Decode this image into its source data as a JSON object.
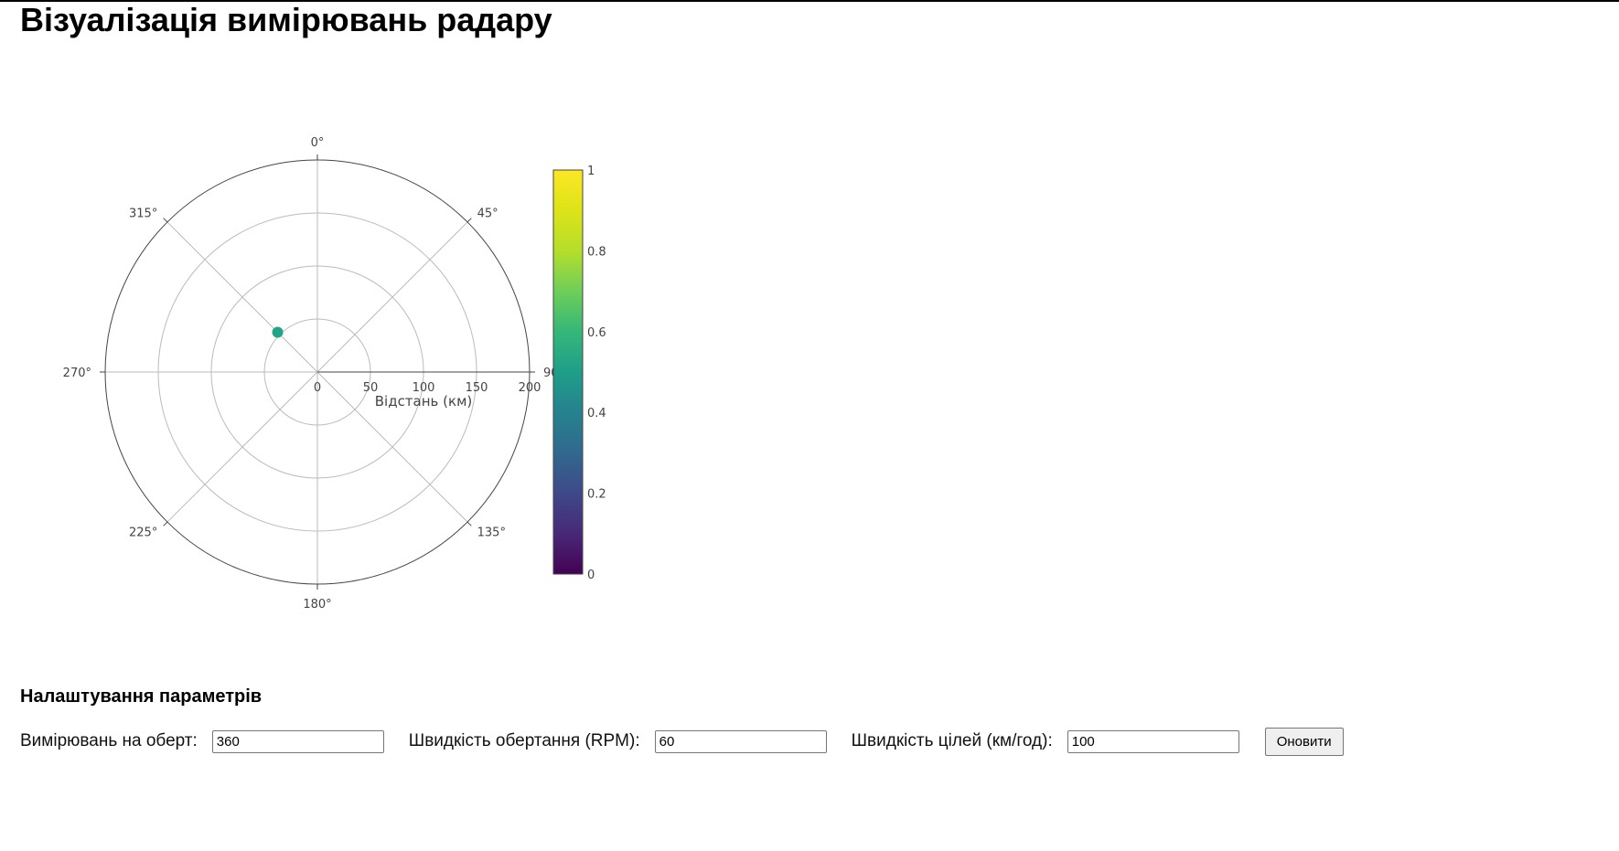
{
  "page": {
    "title": "Візуалізація вимірювань радару"
  },
  "chart_data": {
    "type": "scatter",
    "coordinate_system": "polar",
    "angular_axis": {
      "direction": "clockwise",
      "zero_at": "top",
      "ticks": [
        "0°",
        "45°",
        "90°",
        "135°",
        "180°",
        "225°",
        "270°",
        "315°"
      ],
      "tick_values": [
        0,
        45,
        90,
        135,
        180,
        225,
        270,
        315
      ]
    },
    "radial_axis": {
      "title": "Відстань (км)",
      "range": [
        0,
        200
      ],
      "ticks": [
        0,
        50,
        100,
        150,
        200
      ],
      "angle": 90
    },
    "series": [
      {
        "points": [
          {
            "theta": 315,
            "r": 53,
            "color_value": 0.55
          }
        ]
      }
    ],
    "colorbar": {
      "colorscale": "Viridis",
      "range": [
        0,
        1
      ],
      "ticks": [
        "0",
        "0.2",
        "0.4",
        "0.6",
        "0.8",
        "1"
      ],
      "tick_values": [
        0,
        0.2,
        0.4,
        0.6,
        0.8,
        1
      ]
    },
    "grid": true,
    "colors": {
      "grid": "#bbbbbb",
      "outline": "#444444",
      "point": "#21a685"
    }
  },
  "settings": {
    "heading": "Налаштування параметрів",
    "measurements_label": "Вимірювань на оберт:",
    "measurements_value": "360",
    "rpm_label": "Швидкість обертання (RPM):",
    "rpm_value": "60",
    "target_speed_label": "Швидкість цілей (км/год):",
    "target_speed_value": "100",
    "update_button": "Оновити"
  }
}
